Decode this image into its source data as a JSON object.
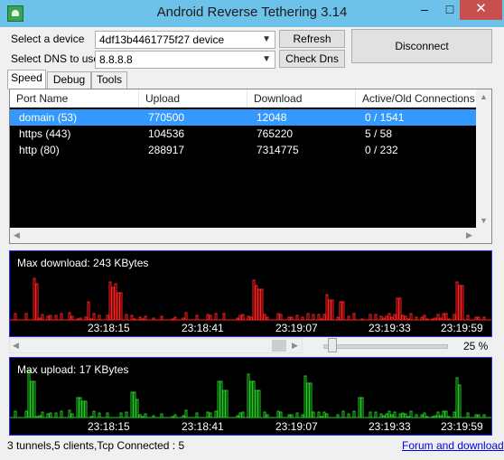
{
  "window": {
    "title": "Android Reverse Tethering 3.14",
    "minimize_glyph": "–",
    "maximize_glyph": "□",
    "close_glyph": "✕"
  },
  "device": {
    "label": "Select a device",
    "value": "4df13b4461775f27  device"
  },
  "dns": {
    "label": "Select DNS to use",
    "value": "8.8.8.8"
  },
  "buttons": {
    "refresh": "Refresh",
    "check_dns": "Check Dns",
    "disconnect": "Disconnect"
  },
  "tabs": [
    "Speed",
    "Debug",
    "Tools"
  ],
  "table": {
    "headers": [
      "Port Name",
      "Upload",
      "Download",
      "Active/Old Connections"
    ],
    "rows": [
      [
        "domain (53)",
        "770500",
        "12048",
        "0 / 1541"
      ],
      [
        "https (443)",
        "104536",
        "765220",
        "5 / 58"
      ],
      [
        "http (80)",
        "288917",
        "7314775",
        "0 / 232"
      ]
    ]
  },
  "download_graph": {
    "title": "Max download: 243 KBytes",
    "ticks": [
      "23:18:15",
      "23:18:41",
      "23:19:07",
      "23:19:33",
      "23:19:59"
    ],
    "color": "#ff2020"
  },
  "zoom": {
    "value": "25 %",
    "slider_fraction": 0.05
  },
  "upload_graph": {
    "title": "Max upload: 17 KBytes",
    "ticks": [
      "23:18:15",
      "23:18:41",
      "23:19:07",
      "23:19:33",
      "23:19:59"
    ],
    "color": "#22cc22"
  },
  "status": {
    "text": "3 tunnels,5 clients,Tcp Connected : 5",
    "link": "Forum and download"
  }
}
